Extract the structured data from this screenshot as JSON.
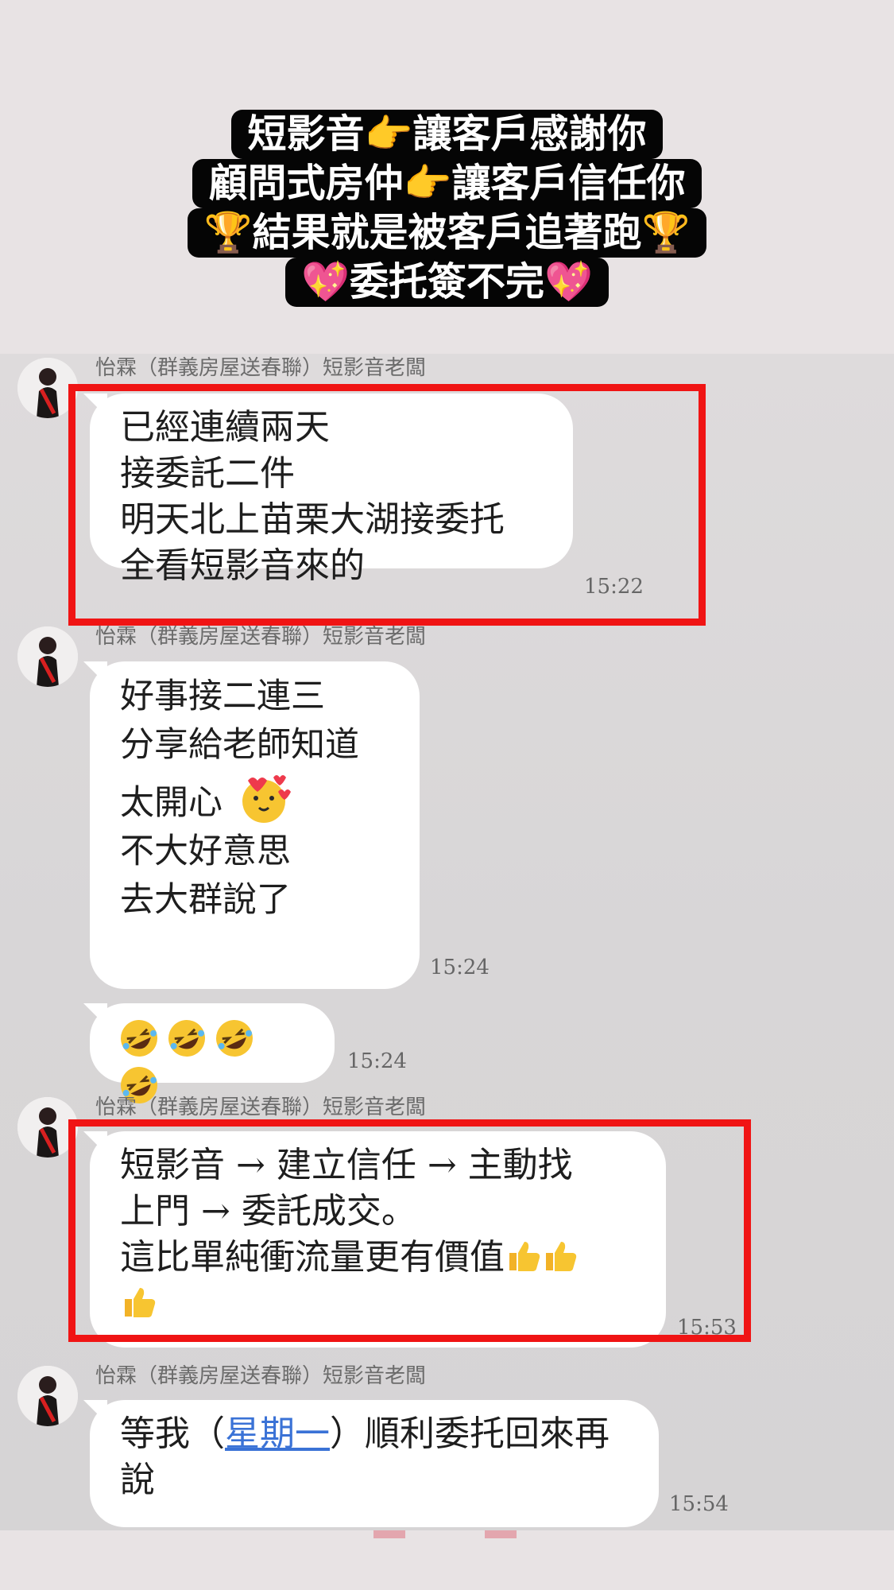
{
  "headline": {
    "lines": [
      "短影音👉讓客戶感謝你",
      "顧問式房仲👉讓客戶信任你",
      "🏆結果就是被客戶追著跑🏆",
      "💖委托簽不完💖"
    ]
  },
  "messages": [
    {
      "sender": "怡霖（群義房屋送春聯）短影音老闆",
      "lines": [
        "已經連續兩天",
        "接委託二件",
        "明天北上苗栗大湖接委托",
        "全看短影音來的"
      ],
      "time": "15:22"
    },
    {
      "sender": "怡霖（群義房屋送春聯）短影音老闆",
      "lines": [
        "好事接二連三",
        "分享給老師知道",
        "太開心",
        "不大好意思",
        "去大群說了"
      ],
      "time": "15:24"
    },
    {
      "sender": "",
      "lines": [],
      "emoji_count": 4,
      "time": "15:24"
    },
    {
      "sender": "怡霖（群義房屋送春聯）短影音老闆",
      "lines": [
        "短影音 → 建立信任 → 主動找",
        "上門 → 委託成交。",
        "這比單純衝流量更有價值"
      ],
      "time": "15:53"
    },
    {
      "sender": "怡霖（群義房屋送春聯）短影音老闆",
      "prefix": "等我（",
      "link": "星期一",
      "suffix": "）順利委托回來再",
      "line2": "說",
      "time": "15:54"
    }
  ],
  "colors": {
    "highlight": "#f01414",
    "link": "#3a72d6",
    "bubble": "#ffffff"
  },
  "icons": [
    "avatar-photo",
    "heart-eyes-emoji",
    "rolling-laughing-emoji",
    "thumbs-up-emoji"
  ]
}
